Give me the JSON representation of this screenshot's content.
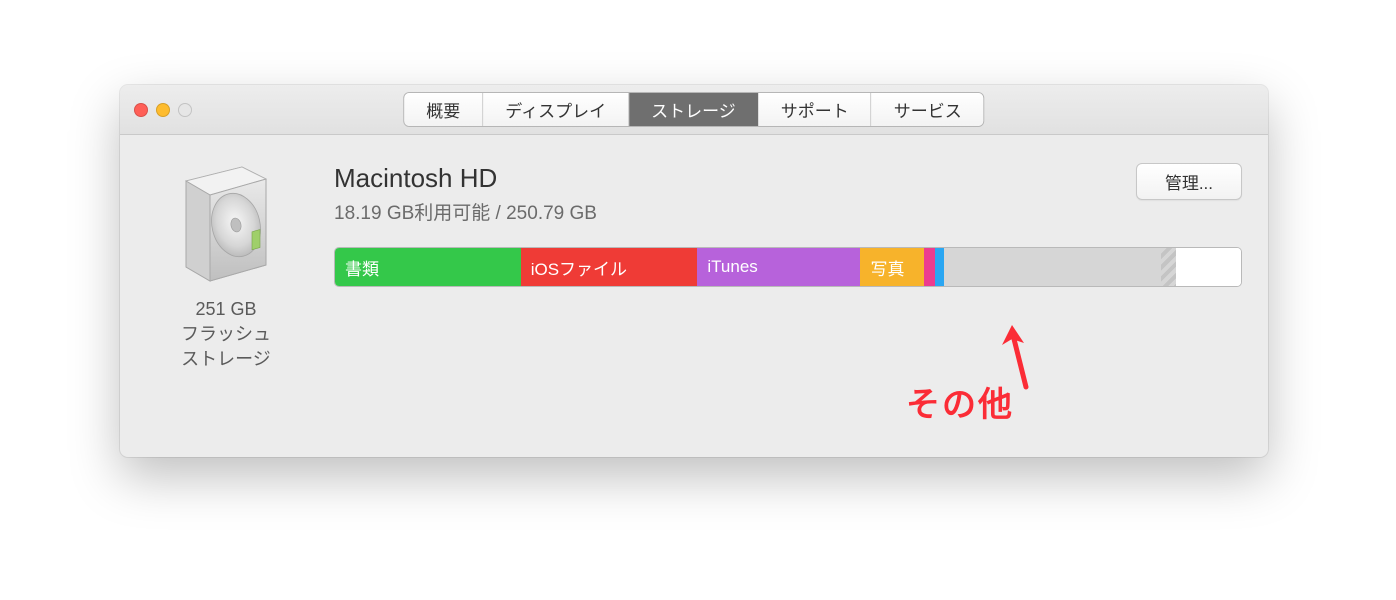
{
  "tabs": {
    "overview": "概要",
    "display": "ディスプレイ",
    "storage": "ストレージ",
    "support": "サポート",
    "service": "サービス"
  },
  "drive": {
    "capacity_line": "251 GB",
    "type_line1": "フラッシュ",
    "type_line2": "ストレージ"
  },
  "disk": {
    "name": "Macintosh HD",
    "subtitle": "18.19 GB利用可能 / 250.79 GB"
  },
  "manage_label": "管理...",
  "segments": {
    "documents": "書類",
    "ios": "iOSファイル",
    "itunes": "iTunes",
    "photos": "写真"
  },
  "annotation_text": "その他"
}
